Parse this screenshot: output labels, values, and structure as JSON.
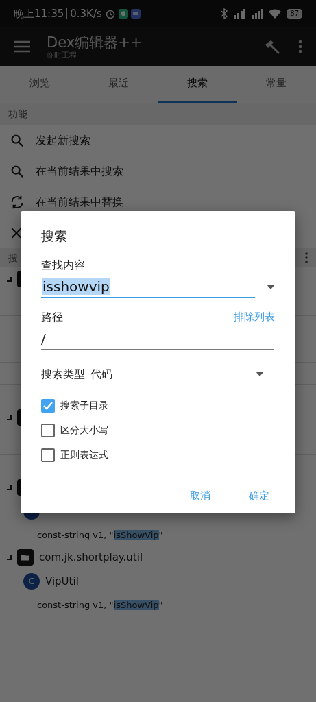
{
  "status_bar": {
    "time": "晚上11:35",
    "speed": "0.3K/s",
    "battery": "87"
  },
  "app_bar": {
    "title": "Dex编辑器++",
    "subtitle": "临时工程"
  },
  "tabs": [
    {
      "label": "浏览",
      "selected": false
    },
    {
      "label": "最近",
      "selected": false
    },
    {
      "label": "搜索",
      "selected": true
    },
    {
      "label": "常量",
      "selected": false
    }
  ],
  "functions": {
    "header": "功能",
    "items": [
      {
        "kind": "search",
        "label": "发起新搜索"
      },
      {
        "kind": "search",
        "label": "在当前结果中搜索"
      },
      {
        "kind": "replace",
        "label": "在当前结果中替换"
      },
      {
        "kind": "clear"
      }
    ]
  },
  "results": {
    "header": "搜",
    "rows": [
      {
        "kind": "folder"
      },
      {
        "kind": "blank"
      },
      {
        "kind": "code"
      },
      {
        "kind": "blank"
      },
      {
        "kind": "code"
      },
      {
        "kind": "code"
      },
      {
        "kind": "folder"
      },
      {
        "kind": "blank"
      },
      {
        "kind": "code"
      },
      {
        "kind": "folder"
      },
      {
        "kind": "class"
      },
      {
        "kind": "code",
        "before": "const-string v1, \"",
        "match": "isShowVip",
        "after": "\""
      },
      {
        "kind": "folder",
        "label": "com.jk.shortplay.util"
      },
      {
        "kind": "class",
        "icon": "C",
        "label": "VipUtil"
      },
      {
        "kind": "code",
        "before": "const-string v1, \"",
        "match": "isShowVip",
        "after": "\""
      }
    ]
  },
  "dialog": {
    "title": "搜索",
    "find_label": "查找内容",
    "find_value": "isshowvip",
    "path_label": "路径",
    "exclude_link": "排除列表",
    "path_value": "/",
    "type_label": "搜索类型",
    "type_value": "代码",
    "options": [
      {
        "label": "搜索子目录",
        "checked": true
      },
      {
        "label": "区分大小写",
        "checked": false
      },
      {
        "label": "正则表达式",
        "checked": false
      }
    ],
    "buttons": [
      "取消",
      "确定"
    ]
  }
}
